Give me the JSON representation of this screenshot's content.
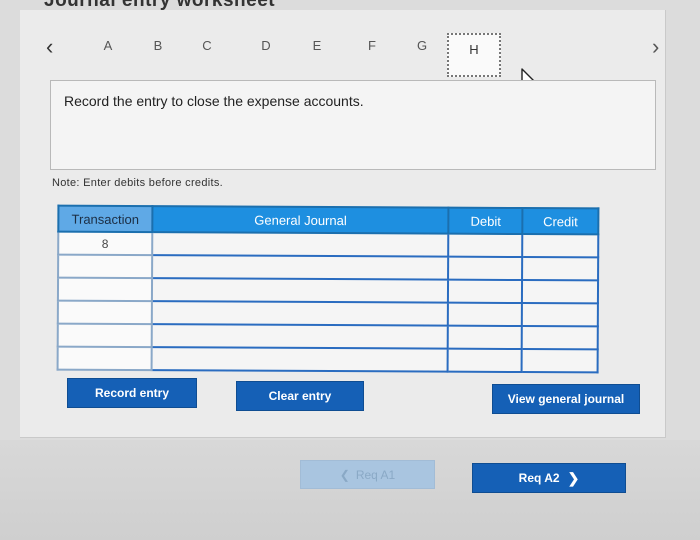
{
  "page": {
    "title": "Journal entry worksheet"
  },
  "tabs": {
    "prev_icon": "‹",
    "next_icon": "›",
    "items": [
      "A",
      "B",
      "C",
      "D",
      "E",
      "F",
      "G",
      "H"
    ],
    "active": "H"
  },
  "instruction": {
    "text": "Record the entry to close the expense accounts."
  },
  "note": {
    "text": "Note: Enter debits before credits."
  },
  "journal": {
    "headers": {
      "transaction": "Transaction",
      "general_journal": "General Journal",
      "debit": "Debit",
      "credit": "Credit"
    },
    "rows": [
      {
        "transaction": "8",
        "account": "",
        "debit": "",
        "credit": ""
      },
      {
        "transaction": "",
        "account": "",
        "debit": "",
        "credit": ""
      },
      {
        "transaction": "",
        "account": "",
        "debit": "",
        "credit": ""
      },
      {
        "transaction": "",
        "account": "",
        "debit": "",
        "credit": ""
      },
      {
        "transaction": "",
        "account": "",
        "debit": "",
        "credit": ""
      },
      {
        "transaction": "",
        "account": "",
        "debit": "",
        "credit": ""
      }
    ]
  },
  "buttons": {
    "record_entry": "Record entry",
    "clear_entry": "Clear entry",
    "view_general_journal": "View general journal",
    "req_a1": "Req A1",
    "req_a2": "Req A2"
  },
  "colors": {
    "accent": "#1560b6",
    "header_blue": "#1e8fe0",
    "disabled": "#a9c5e0"
  }
}
